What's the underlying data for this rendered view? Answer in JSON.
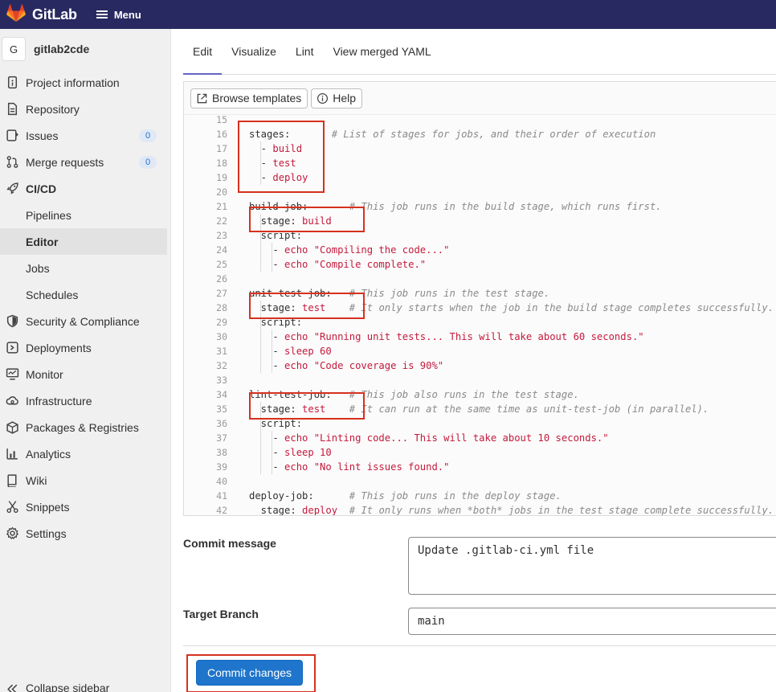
{
  "topbar": {
    "brand": "GitLab",
    "menu_label": "Menu"
  },
  "sidebar": {
    "project_initial": "G",
    "project_name": "gitlab2cde",
    "items": [
      {
        "label": "Project information",
        "icon": "info-icon"
      },
      {
        "label": "Repository",
        "icon": "doc-icon"
      },
      {
        "label": "Issues",
        "icon": "issues-icon",
        "badge": "0"
      },
      {
        "label": "Merge requests",
        "icon": "merge-request-icon",
        "badge": "0"
      },
      {
        "label": "CI/CD",
        "icon": "rocket-icon"
      },
      {
        "label": "Pipelines"
      },
      {
        "label": "Editor"
      },
      {
        "label": "Jobs"
      },
      {
        "label": "Schedules"
      },
      {
        "label": "Security & Compliance",
        "icon": "shield-icon"
      },
      {
        "label": "Deployments",
        "icon": "deployments-icon"
      },
      {
        "label": "Monitor",
        "icon": "monitor-icon"
      },
      {
        "label": "Infrastructure",
        "icon": "cloud-gear-icon"
      },
      {
        "label": "Packages & Registries",
        "icon": "package-icon"
      },
      {
        "label": "Analytics",
        "icon": "chart-icon"
      },
      {
        "label": "Wiki",
        "icon": "book-icon"
      },
      {
        "label": "Snippets",
        "icon": "scissors-icon"
      },
      {
        "label": "Settings",
        "icon": "gear-icon"
      }
    ],
    "collapse_label": "Collapse sidebar"
  },
  "tabs": [
    "Edit",
    "Visualize",
    "Lint",
    "View merged YAML"
  ],
  "toolbar": {
    "browse_templates": "Browse templates",
    "help": "Help"
  },
  "code_lines": [
    {
      "n": "15",
      "parts": []
    },
    {
      "n": "16",
      "parts": [
        [
          "kw",
          "stages:"
        ],
        [
          "sp",
          "       "
        ],
        [
          "cm",
          "# List of stages for jobs, and their order of execution"
        ]
      ]
    },
    {
      "n": "17",
      "parts": [
        [
          "kw",
          "  - "
        ],
        [
          "str",
          "build"
        ]
      ]
    },
    {
      "n": "18",
      "parts": [
        [
          "kw",
          "  - "
        ],
        [
          "str",
          "test"
        ]
      ]
    },
    {
      "n": "19",
      "parts": [
        [
          "kw",
          "  - "
        ],
        [
          "str",
          "deploy"
        ]
      ]
    },
    {
      "n": "20",
      "parts": []
    },
    {
      "n": "21",
      "parts": [
        [
          "kw",
          "build-job:"
        ],
        [
          "sp",
          "       "
        ],
        [
          "cm",
          "# This job runs in the build stage, which runs first."
        ]
      ]
    },
    {
      "n": "22",
      "parts": [
        [
          "kw",
          "  stage: "
        ],
        [
          "str",
          "build"
        ]
      ]
    },
    {
      "n": "23",
      "parts": [
        [
          "kw",
          "  script:"
        ]
      ]
    },
    {
      "n": "24",
      "parts": [
        [
          "kw",
          "    - "
        ],
        [
          "str",
          "echo \"Compiling the code...\""
        ]
      ]
    },
    {
      "n": "25",
      "parts": [
        [
          "kw",
          "    - "
        ],
        [
          "str",
          "echo \"Compile complete.\""
        ]
      ]
    },
    {
      "n": "26",
      "parts": []
    },
    {
      "n": "27",
      "parts": [
        [
          "kw",
          "unit-test-job:"
        ],
        [
          "sp",
          "   "
        ],
        [
          "cm",
          "# This job runs in the test stage."
        ]
      ]
    },
    {
      "n": "28",
      "parts": [
        [
          "kw",
          "  stage: "
        ],
        [
          "str",
          "test"
        ],
        [
          "sp",
          "    "
        ],
        [
          "cm",
          "# It only starts when the job in the build stage completes successfully."
        ]
      ]
    },
    {
      "n": "29",
      "parts": [
        [
          "kw",
          "  script:"
        ]
      ]
    },
    {
      "n": "30",
      "parts": [
        [
          "kw",
          "    - "
        ],
        [
          "str",
          "echo \"Running unit tests... This will take about 60 seconds.\""
        ]
      ]
    },
    {
      "n": "31",
      "parts": [
        [
          "kw",
          "    - "
        ],
        [
          "str",
          "sleep 60"
        ]
      ]
    },
    {
      "n": "32",
      "parts": [
        [
          "kw",
          "    - "
        ],
        [
          "str",
          "echo \"Code coverage is 90%\""
        ]
      ]
    },
    {
      "n": "33",
      "parts": []
    },
    {
      "n": "34",
      "parts": [
        [
          "kw",
          "lint-test-job:"
        ],
        [
          "sp",
          "   "
        ],
        [
          "cm",
          "# This job also runs in the test stage."
        ]
      ]
    },
    {
      "n": "35",
      "parts": [
        [
          "kw",
          "  stage: "
        ],
        [
          "str",
          "test"
        ],
        [
          "sp",
          "    "
        ],
        [
          "cm",
          "# It can run at the same time as unit-test-job (in parallel)."
        ]
      ]
    },
    {
      "n": "36",
      "parts": [
        [
          "kw",
          "  script:"
        ]
      ]
    },
    {
      "n": "37",
      "parts": [
        [
          "kw",
          "    - "
        ],
        [
          "str",
          "echo \"Linting code... This will take about 10 seconds.\""
        ]
      ]
    },
    {
      "n": "38",
      "parts": [
        [
          "kw",
          "    - "
        ],
        [
          "str",
          "sleep 10"
        ]
      ]
    },
    {
      "n": "39",
      "parts": [
        [
          "kw",
          "    - "
        ],
        [
          "str",
          "echo \"No lint issues found.\""
        ]
      ]
    },
    {
      "n": "40",
      "parts": []
    },
    {
      "n": "41",
      "parts": [
        [
          "kw",
          "deploy-job:"
        ],
        [
          "sp",
          "      "
        ],
        [
          "cm",
          "# This job runs in the deploy stage."
        ]
      ]
    },
    {
      "n": "42",
      "parts": [
        [
          "kw",
          "  stage: "
        ],
        [
          "str",
          "deploy"
        ],
        [
          "sp",
          "  "
        ],
        [
          "cm",
          "# It only runs when *both* jobs in the test stage complete successfully."
        ]
      ]
    }
  ],
  "commit": {
    "message_label": "Commit message",
    "message_value": "Update .gitlab-ci.yml file",
    "branch_label": "Target Branch",
    "branch_value": "main",
    "button_label": "Commit changes"
  },
  "colors": {
    "navbar": "#292961",
    "primary_button": "#1f75cb",
    "highlight_box": "#d6311f",
    "string": "#c41a3c",
    "comment": "#8a8a8a"
  }
}
